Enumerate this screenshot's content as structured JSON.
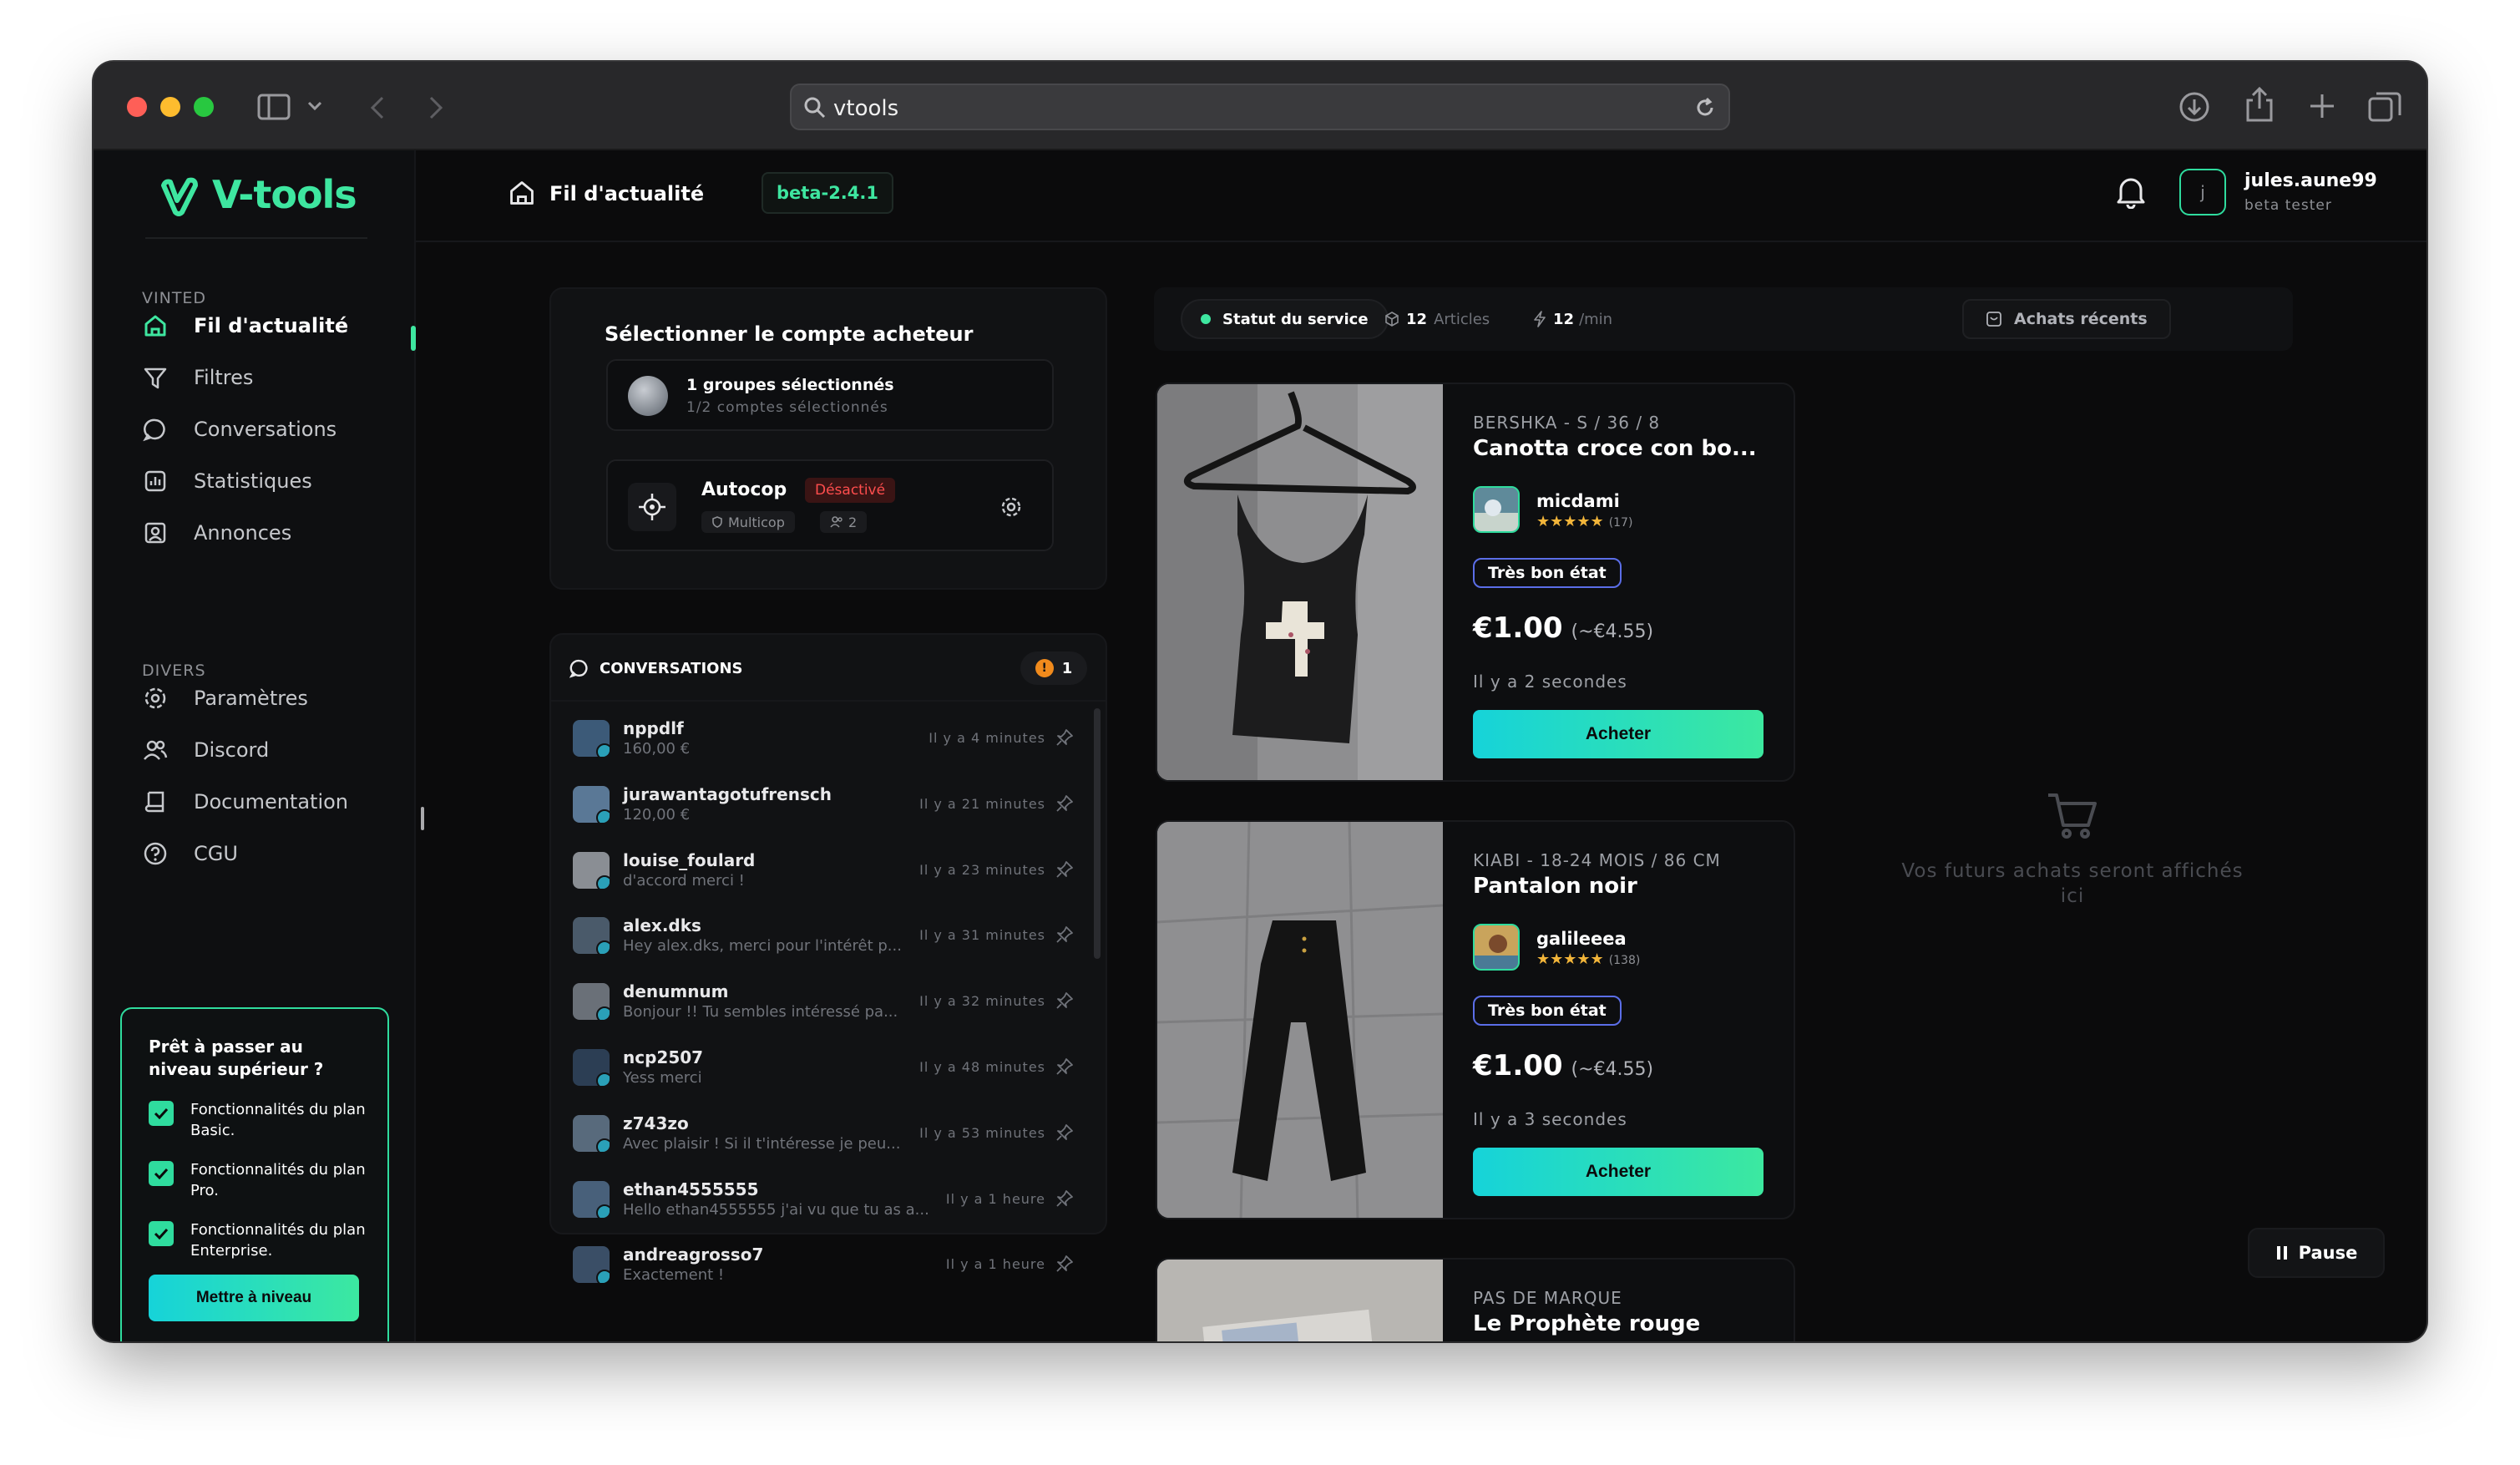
{
  "browser": {
    "url": "vtools"
  },
  "app": {
    "logo": "V-tools",
    "version": "beta-2.4.1"
  },
  "header": {
    "title": "Fil d'actualité",
    "username": "jules.aune99",
    "role": "beta tester",
    "avatar_initial": "j"
  },
  "sidebar": {
    "sections": [
      {
        "title": "VINTED",
        "items": [
          {
            "label": "Fil d'actualité",
            "icon": "home-icon",
            "active": true
          },
          {
            "label": "Filtres",
            "icon": "filter-icon"
          },
          {
            "label": "Conversations",
            "icon": "chat-icon"
          },
          {
            "label": "Statistiques",
            "icon": "stats-icon"
          },
          {
            "label": "Annonces",
            "icon": "listing-icon"
          }
        ]
      },
      {
        "title": "DIVERS",
        "items": [
          {
            "label": "Paramètres",
            "icon": "gear-icon"
          },
          {
            "label": "Discord",
            "icon": "users-icon"
          },
          {
            "label": "Documentation",
            "icon": "book-icon"
          },
          {
            "label": "CGU",
            "icon": "help-icon"
          }
        ]
      }
    ],
    "upgrade": {
      "title": "Prêt à passer au niveau supérieur ?",
      "features": [
        "Fonctionnalités du plan Basic.",
        "Fonctionnalités du plan Pro.",
        "Fonctionnalités du plan Enterprise."
      ],
      "button": "Mettre à niveau"
    }
  },
  "account": {
    "title": "Sélectionner le compte acheteur",
    "groups": "1 groupes sélectionnés",
    "accounts": "1/2 comptes sélectionnés",
    "autocop": {
      "label": "Autocop",
      "status": "Désactivé",
      "tag1": "Multicop",
      "tag2": "2"
    }
  },
  "conversations": {
    "title": "CONVERSATIONS",
    "badge": "1",
    "items": [
      {
        "name": "nppdlf",
        "msg": "160,00 €",
        "time": "Il y a 4 minutes"
      },
      {
        "name": "jurawantagotufrensch",
        "msg": "120,00 €",
        "time": "Il y a 21 minutes"
      },
      {
        "name": "louise_foulard",
        "msg": "d'accord merci !",
        "time": "Il y a 23 minutes"
      },
      {
        "name": "alex.dks",
        "msg": "Hey alex.dks, merci pour l'intérêt p...",
        "time": "Il y a 31 minutes"
      },
      {
        "name": "denumnum",
        "msg": "Bonjour !! Tu sembles intéressé pa...",
        "time": "Il y a 32 minutes"
      },
      {
        "name": "ncp2507",
        "msg": "Yess merci",
        "time": "Il y a 48 minutes"
      },
      {
        "name": "z743zo",
        "msg": "Avec plaisir ! Si il t'intéresse je peu...",
        "time": "Il y a 53 minutes"
      },
      {
        "name": "ethan4555555",
        "msg": "Hello ethan4555555 j'ai vu que tu as a...",
        "time": "Il y a 1 heure"
      },
      {
        "name": "andreagrosso7",
        "msg": "Exactement !",
        "time": "Il y a 1 heure"
      }
    ]
  },
  "status": {
    "service": "Statut du service",
    "articles_count": "12",
    "articles_label": "Articles",
    "rate_count": "12",
    "rate_label": "/min",
    "recent": "Achats récents"
  },
  "items": [
    {
      "brand": "BERSHKA - S / 36 / 8",
      "title": "Canotta croce con bo...",
      "seller": "micdami",
      "reviews": "(17)",
      "condition": "Très bon état",
      "price": "€1.00",
      "price_total": "(~€4.55)",
      "time": "Il y a 2 secondes",
      "buy": "Acheter"
    },
    {
      "brand": "KIABI - 18-24 MOIS / 86 CM",
      "title": "Pantalon noir",
      "seller": "galileeea",
      "reviews": "(138)",
      "condition": "Très bon état",
      "price": "€1.00",
      "price_total": "(~€4.55)",
      "time": "Il y a 3 secondes",
      "buy": "Acheter"
    },
    {
      "brand": "PAS DE MARQUE",
      "title": "Le Prophète rouge"
    }
  ],
  "empty_state": "Vos futurs achats seront affichés ici",
  "pause": "Pause",
  "stars": "★★★★★"
}
